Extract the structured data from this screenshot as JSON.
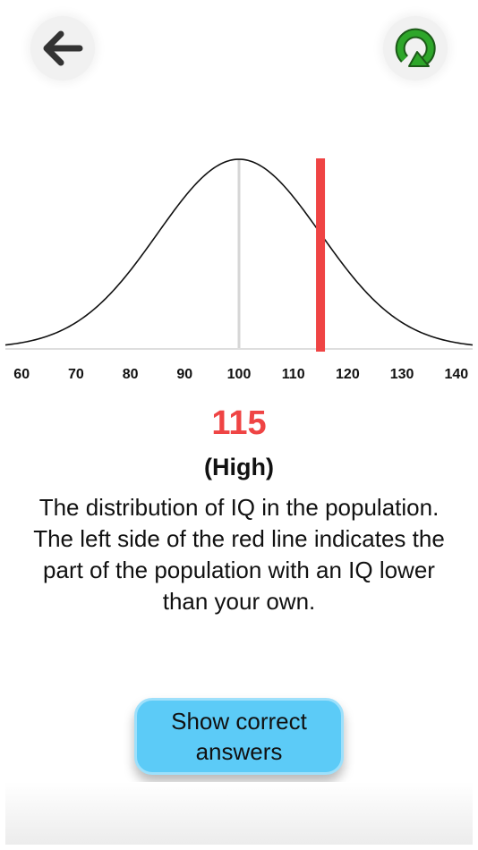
{
  "header": {
    "back_icon": "arrow-left-icon",
    "restart_icon": "restart-icon",
    "restart_color": "#2ea62a"
  },
  "chart_data": {
    "type": "line",
    "curve": "normal-distribution",
    "mean": 100,
    "std_dev": 15,
    "xlim": [
      57,
      143
    ],
    "x_ticks": [
      60,
      70,
      80,
      90,
      100,
      110,
      120,
      130,
      140
    ],
    "x_tick_labels": [
      "60",
      "70",
      "80",
      "90",
      "100",
      "110",
      "120",
      "130",
      "140"
    ],
    "mean_line_x": 100,
    "marker_x": 115,
    "marker_color": "#ef4444",
    "curve_color": "#111111",
    "mean_line_color": "#d6d6d6",
    "grid": false
  },
  "result": {
    "score": "115",
    "level": "(High)",
    "score_color": "#ef4444",
    "description": "The distribution of IQ in the population. The left side of the red line indicates the part of the population with an IQ lower than your own."
  },
  "actions": {
    "show_answers_label": "Show correct answers",
    "show_answers_color": "#5ccbf7"
  }
}
